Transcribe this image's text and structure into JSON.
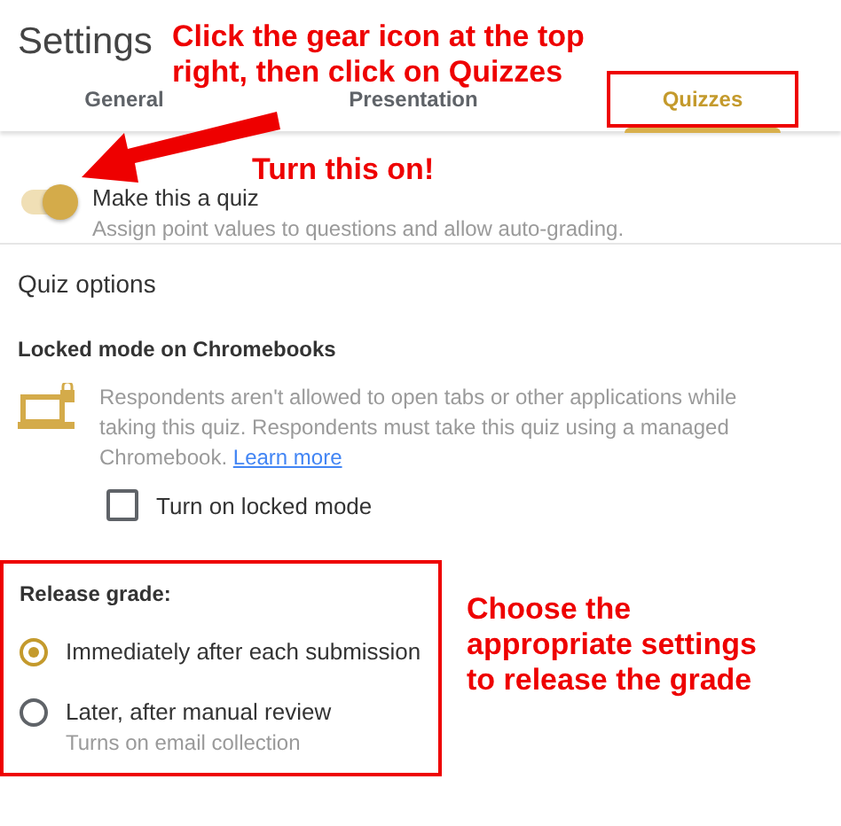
{
  "title": "Settings",
  "tabs": [
    {
      "label": "General",
      "selected": false,
      "highlighted": false
    },
    {
      "label": "Presentation",
      "selected": false,
      "highlighted": false
    },
    {
      "label": "Quizzes",
      "selected": true,
      "highlighted": true
    }
  ],
  "quiz_toggle": {
    "label": "Make this a quiz",
    "description": "Assign point values to questions and allow auto-grading.",
    "on": true
  },
  "section_title": "Quiz options",
  "locked_mode": {
    "title": "Locked mode on Chromebooks",
    "description": "Respondents aren't allowed to open tabs or other applications while taking this quiz. Respondents must take this quiz using a managed Chromebook.",
    "link": "Learn more",
    "checkbox": {
      "label": "Turn on locked mode",
      "checked": false
    }
  },
  "release_grade": {
    "title": "Release grade:",
    "highlighted": true,
    "options": [
      {
        "label": "Immediately after each submission",
        "selected": true
      },
      {
        "label": "Later, after manual review",
        "hint": "Turns on email collection",
        "selected": false
      }
    ]
  },
  "annotations": [
    {
      "text": "Click the gear icon at the top right, then click on Quizzes"
    },
    {
      "text": "Turn this on!"
    },
    {
      "text": "Choose the appropriate settings to release the grade"
    }
  ]
}
